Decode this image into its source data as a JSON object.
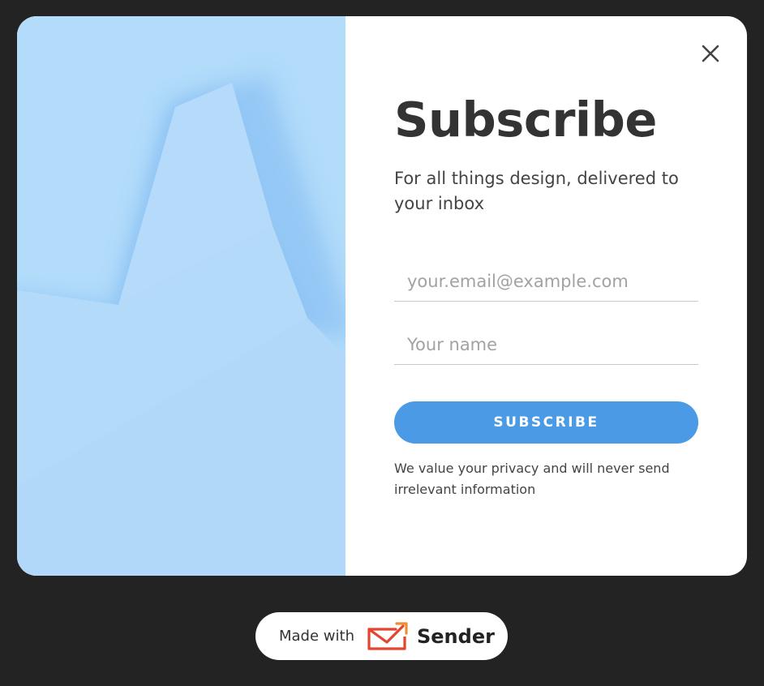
{
  "popup": {
    "title": "Subscribe",
    "subtitle": "For all things design, delivered to your inbox",
    "email_placeholder": "your.email@example.com",
    "name_placeholder": "Your name",
    "button_label": "SUBSCRIBE",
    "privacy_note": "We value your privacy and will never send irrelevant information",
    "close_icon": "close-icon",
    "accent_color": "#4a9ae6",
    "hero_color": "#b3dcfa"
  },
  "badge": {
    "made_with": "Made with",
    "brand": "Sender",
    "logo_icon": "sender-envelope-icon",
    "logo_colors": [
      "#e4432d",
      "#f08c2e"
    ]
  }
}
